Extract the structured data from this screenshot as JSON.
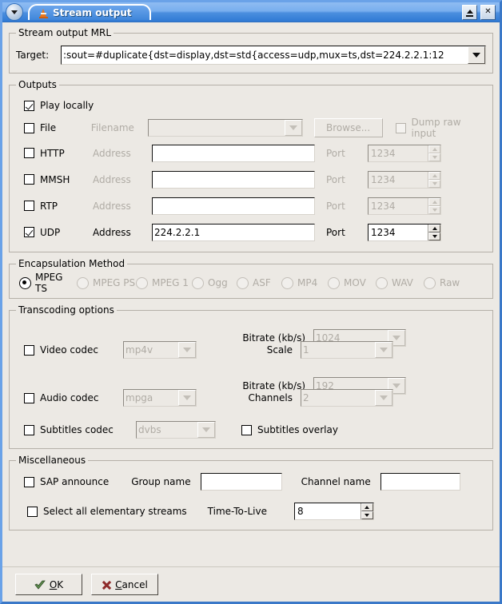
{
  "window": {
    "title": "Stream output",
    "menu_icon": "window-menu-icon",
    "app_icon": "vlc-cone-icon",
    "shade_button": "shade-window-button",
    "close_button": "close-window-button",
    "close_label": "✕"
  },
  "mrl": {
    "legend": "Stream output MRL",
    "target_label": "Target:",
    "target_value": ":sout=#duplicate{dst=display,dst=std{access=udp,mux=ts,dst=224.2.2.1:12",
    "dropdown_icon": "chevron-down-icon"
  },
  "outputs": {
    "legend": "Outputs",
    "play_locally": {
      "label": "Play locally",
      "checked": true
    },
    "file": {
      "label": "File",
      "checked": false,
      "field_label": "Filename",
      "field_value": "",
      "browse_label": "Browse...",
      "dump_label": "Dump raw input",
      "dump_checked": false
    },
    "http": {
      "label": "HTTP",
      "checked": false,
      "field_label": "Address",
      "address": "",
      "port_label": "Port",
      "port": "1234"
    },
    "mmsh": {
      "label": "MMSH",
      "checked": false,
      "field_label": "Address",
      "address": "",
      "port_label": "Port",
      "port": "1234"
    },
    "rtp": {
      "label": "RTP",
      "checked": false,
      "field_label": "Address",
      "address": "",
      "port_label": "Port",
      "port": "1234"
    },
    "udp": {
      "label": "UDP",
      "checked": true,
      "field_label": "Address",
      "address": "224.2.2.1",
      "port_label": "Port",
      "port": "1234"
    }
  },
  "encapsulation": {
    "legend": "Encapsulation Method",
    "options": [
      {
        "label": "MPEG TS",
        "selected": true,
        "enabled": true
      },
      {
        "label": "MPEG PS",
        "selected": false,
        "enabled": false
      },
      {
        "label": "MPEG 1",
        "selected": false,
        "enabled": false
      },
      {
        "label": "Ogg",
        "selected": false,
        "enabled": false
      },
      {
        "label": "ASF",
        "selected": false,
        "enabled": false
      },
      {
        "label": "MP4",
        "selected": false,
        "enabled": false
      },
      {
        "label": "MOV",
        "selected": false,
        "enabled": false
      },
      {
        "label": "WAV",
        "selected": false,
        "enabled": false
      },
      {
        "label": "Raw",
        "selected": false,
        "enabled": false
      }
    ]
  },
  "transcoding": {
    "legend": "Transcoding options",
    "video": {
      "label": "Video codec",
      "checked": false,
      "codec": "mp4v",
      "bitrate_label": "Bitrate (kb/s)",
      "bitrate": "1024",
      "scale_label": "Scale",
      "scale": "1"
    },
    "audio": {
      "label": "Audio codec",
      "checked": false,
      "codec": "mpga",
      "bitrate_label": "Bitrate (kb/s)",
      "bitrate": "192",
      "channels_label": "Channels",
      "channels": "2"
    },
    "subtitles": {
      "label": "Subtitles codec",
      "checked": false,
      "codec": "dvbs",
      "overlay_label": "Subtitles overlay",
      "overlay_checked": false
    }
  },
  "misc": {
    "legend": "Miscellaneous",
    "sap_label": "SAP announce",
    "sap_checked": false,
    "group_name_label": "Group name",
    "group_name": "",
    "channel_name_label": "Channel name",
    "channel_name": "",
    "select_all_label": "Select all elementary streams",
    "select_all_checked": false,
    "ttl_label": "Time-To-Live",
    "ttl": "8"
  },
  "footer": {
    "ok_prefix": "",
    "ok_accel": "O",
    "ok_rest": "K",
    "cancel_prefix": "",
    "cancel_accel": "C",
    "cancel_rest": "ancel",
    "ok_icon": "ok-check-icon",
    "cancel_icon": "cancel-x-icon"
  },
  "colors": {
    "window_bg": "#ece9e4",
    "titlebar_blue": "#3f86da",
    "field_bg": "#ffffff",
    "disabled_text": "#b0aca5"
  }
}
